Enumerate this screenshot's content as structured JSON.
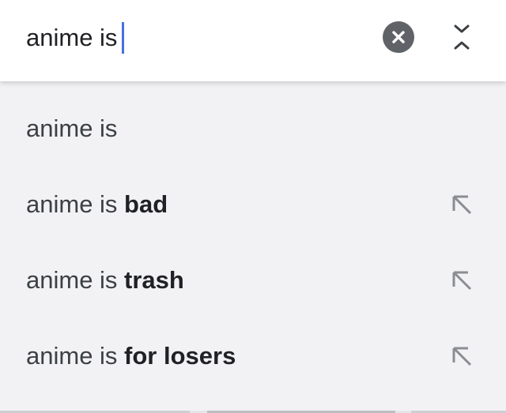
{
  "search": {
    "query": "anime is"
  },
  "suggestions": [
    {
      "prefix": "anime is",
      "completion": "",
      "has_fill_arrow": false
    },
    {
      "prefix": "anime is ",
      "completion": "bad",
      "has_fill_arrow": true
    },
    {
      "prefix": "anime is ",
      "completion": "trash",
      "has_fill_arrow": true
    },
    {
      "prefix": "anime is ",
      "completion": "for losers",
      "has_fill_arrow": true
    }
  ],
  "icons": {
    "clear": "close-circle-icon",
    "collapse": "collapse-icon",
    "fill": "north-west-arrow-icon"
  },
  "colors": {
    "caret": "#4a6fe0",
    "clear_button": "#5f6368",
    "background": "#f2f2f4"
  }
}
